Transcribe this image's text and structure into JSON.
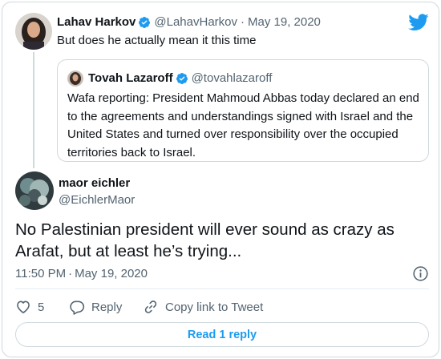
{
  "parent": {
    "name": "Lahav Harkov",
    "handle": "@LahavHarkov",
    "separator": "·",
    "date": "May 19, 2020",
    "text": "But does he actually mean it this time"
  },
  "quote": {
    "name": "Tovah Lazaroff",
    "handle": "@tovahlazaroff",
    "text": "Wafa reporting: President Mahmoud Abbas today declared an end to the agreements and understandings signed with Israel and the United States and turned over responsibility over the occupied territories back to Israel."
  },
  "tweet": {
    "name": "maor eichler",
    "handle": "@EichlerMaor",
    "text": "No Palestinian president will ever sound as crazy as Arafat, but at least he’s trying...",
    "time": "11:50 PM",
    "separator": "·",
    "date": "May 19, 2020"
  },
  "actions": {
    "like_count": "5",
    "reply_label": "Reply",
    "copy_label": "Copy link to Tweet"
  },
  "read_replies_label": "Read 1 reply",
  "icons": {
    "logo": "twitter-bird-icon",
    "verified": "verified-badge-icon",
    "info": "info-icon",
    "like": "heart-icon",
    "reply": "speech-bubble-icon",
    "copy": "link-icon"
  },
  "colors": {
    "accent": "#1d9bf0",
    "text": "#0f1419",
    "muted": "#536471",
    "border": "#cfd9de"
  }
}
